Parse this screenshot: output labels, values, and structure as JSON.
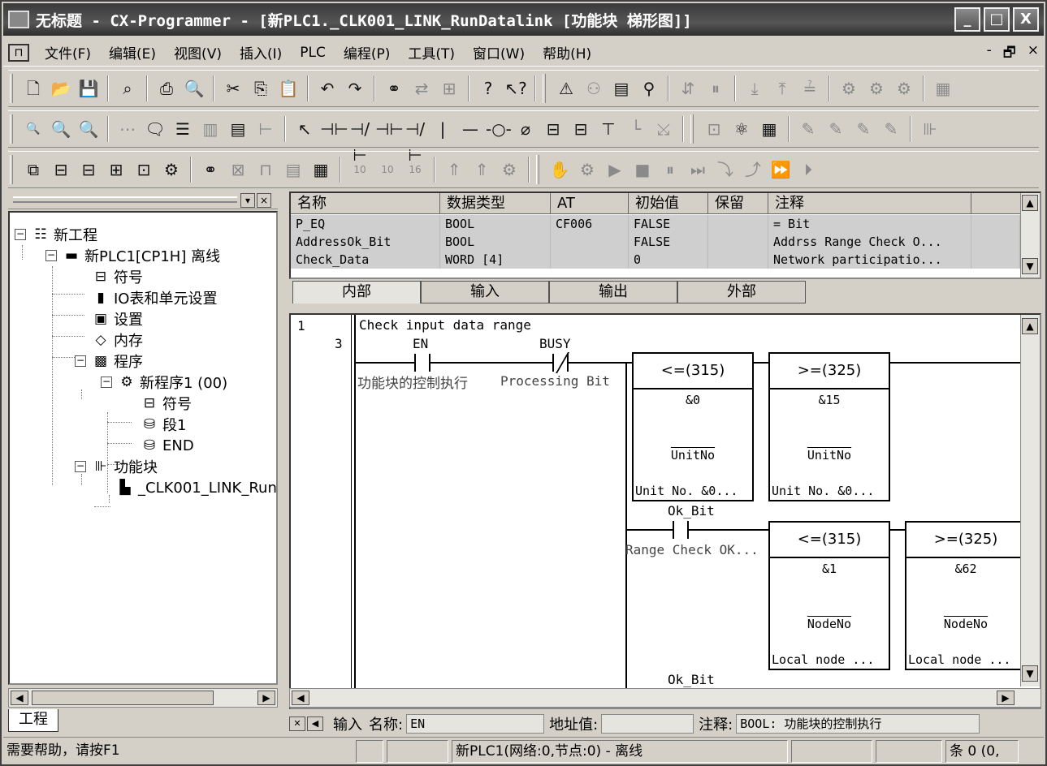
{
  "window": {
    "title": "无标题 - CX-Programmer - [新PLC1._CLK001_LINK_RunDatalink [功能块 梯形图]]",
    "buttons": [
      "_",
      "□",
      "X"
    ]
  },
  "menu": {
    "items": [
      "文件(F)",
      "编辑(E)",
      "视图(V)",
      "插入(I)",
      "PLC",
      "编程(P)",
      "工具(T)",
      "窗口(W)",
      "帮助(H)"
    ],
    "mdi_buttons": [
      "-",
      "🗗",
      "×"
    ]
  },
  "tree": {
    "root": "新工程",
    "plc": "新PLC1[CP1H] 离线",
    "items": {
      "symbols": "符号",
      "io": "IO表和单元设置",
      "settings": "设置",
      "memory": "内存",
      "program": "程序",
      "newprogram": "新程序1 (00)",
      "prog_symbols": "符号",
      "section": "段1",
      "end": "END",
      "fb": "功能块",
      "fb_item": "_CLK001_LINK_Run"
    },
    "tab_label": "工程"
  },
  "vartable": {
    "columns": [
      "名称",
      "数据类型",
      "AT",
      "初始值",
      "保留",
      "注释"
    ],
    "rows": [
      [
        "P_EQ",
        "BOOL",
        "CF006",
        "FALSE",
        "",
        "= Bit"
      ],
      [
        "AddressOk_Bit",
        "BOOL",
        "",
        "FALSE",
        "",
        "Addrss Range Check O..."
      ],
      [
        "Check_Data",
        "WORD [4]",
        "",
        "0",
        "",
        "Network participatio..."
      ]
    ],
    "tabs": [
      "内部",
      "输入",
      "输出",
      "外部"
    ]
  },
  "ladder": {
    "rung_number": "1",
    "step_number": "3",
    "rung_comment": "Check input data range",
    "contact_en": "EN",
    "contact_en_comment": "功能块的控制执行",
    "contact_busy": "BUSY",
    "contact_busy_comment": "Processing Bit",
    "blocks": [
      {
        "op": "<=(315)",
        "value": "&0",
        "operand": "UnitNo",
        "comment": "Unit No. &0..."
      },
      {
        "op": ">=(325)",
        "value": "&15",
        "operand": "UnitNo",
        "comment": "Unit No. &0..."
      },
      {
        "op": "<=(315)",
        "value": "&1",
        "operand": "NodeNo",
        "comment": "Local node ..."
      },
      {
        "op": ">=(325)",
        "value": "&62",
        "operand": "NodeNo",
        "comment": "Local node ..."
      }
    ],
    "contact_ok": "Ok_Bit",
    "contact_ok_comment": "Range Check OK...",
    "bottom_label": "Ok_Bit"
  },
  "infoline": {
    "tab": "输入",
    "name_label": "名称:",
    "name_value": "EN",
    "address_label": "地址值:",
    "address_value": "",
    "comment_label": "注释:",
    "comment_value": "BOOL: 功能块的控制执行"
  },
  "status": {
    "help": "需要帮助，请按F1",
    "plc": "新PLC1(网络:0,节点:0) - 离线",
    "position": "条 0 (0,"
  }
}
